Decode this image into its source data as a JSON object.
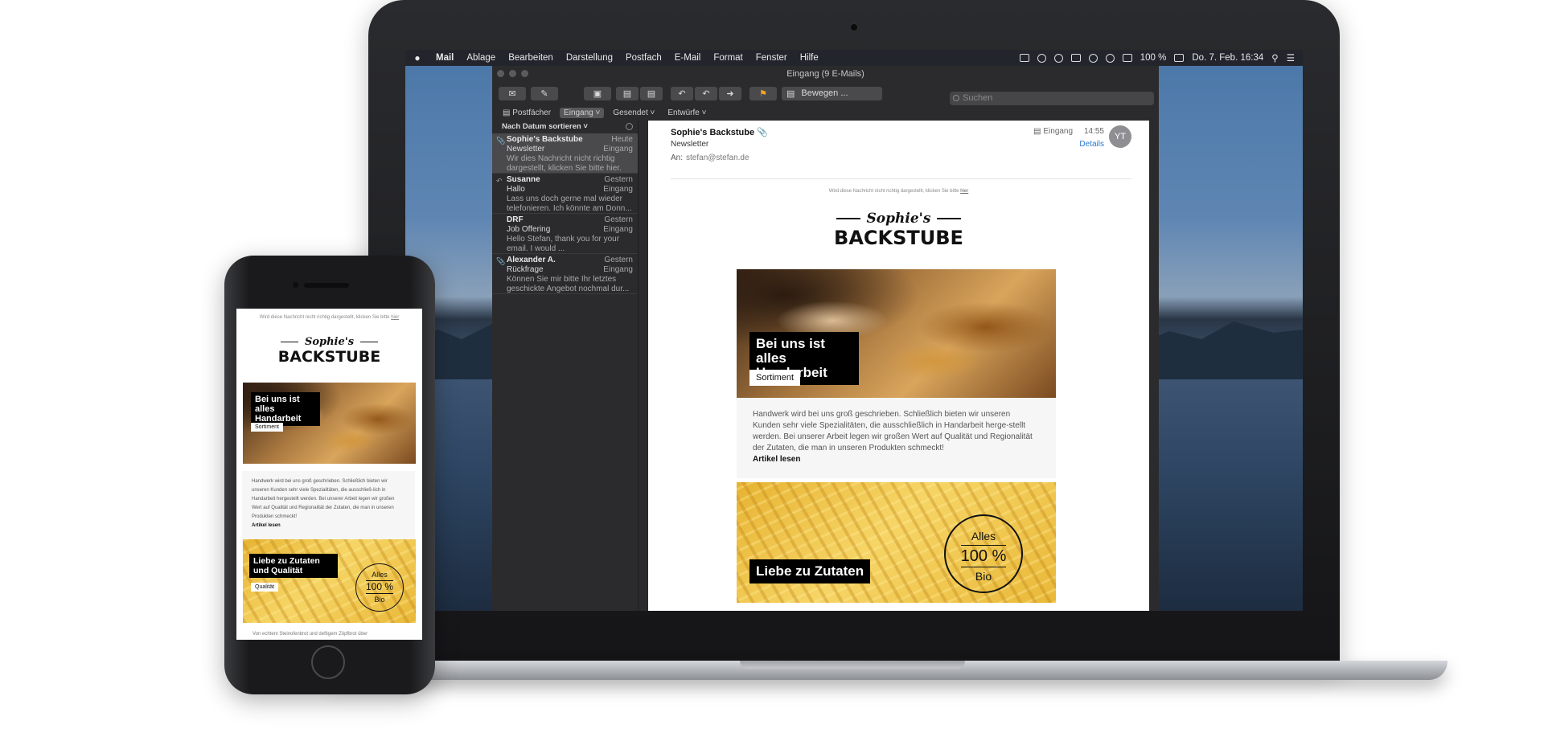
{
  "menubar": {
    "app": "Mail",
    "items": [
      "Ablage",
      "Bearbeiten",
      "Darstellung",
      "Postfach",
      "E-Mail",
      "Format",
      "Fenster",
      "Hilfe"
    ],
    "battery": "100 %",
    "clock": "Do. 7. Feb.  16:34"
  },
  "window": {
    "title": "Eingang (9 E-Mails)"
  },
  "toolbar": {
    "move_label": "Bewegen ...",
    "search_placeholder": "Suchen"
  },
  "favorites": [
    "Postfächer",
    "Eingang",
    "Gesendet",
    "Entwürfe"
  ],
  "sort_label": "Nach Datum sortieren",
  "messages": [
    {
      "from": "Sophie's Backstube",
      "date": "Heute",
      "subject": "Newsletter",
      "mailbox": "Eingang",
      "preview": "Wir dies Nachricht nicht richtig dargestellt, klicken Sie bitte hier."
    },
    {
      "from": "Susanne",
      "date": "Gestern",
      "subject": "Hallo",
      "mailbox": "Eingang",
      "preview": "Lass uns doch gerne mal wieder telefonieren. Ich könnte am Donn..."
    },
    {
      "from": "DRF",
      "date": "Gestern",
      "subject": "Job Offering",
      "mailbox": "Eingang",
      "preview": "Hello Stefan, thank you for your email. I would ..."
    },
    {
      "from": "Alexander A.",
      "date": "Gestern",
      "subject": "Rückfrage",
      "mailbox": "Eingang",
      "preview": "Können Sie mir bitte Ihr letztes geschickte Angebot nochmal dur..."
    }
  ],
  "email": {
    "from": "Sophie's Backstube",
    "subject": "Newsletter",
    "to_label": "An:",
    "to": "stefan@stefan.de",
    "mailbox": "Eingang",
    "time": "14:55",
    "details": "Details",
    "avatar": "YT"
  },
  "newsletter": {
    "topline": "Wird diese Nachricht nicht richtig dargestellt, klicken Sie bitte",
    "topline_link": "hier",
    "logo_script": "Sophie's",
    "logo_word": "BACKSTUBE",
    "hero_title": "Bei uns ist alles Handarbeit",
    "hero_tag": "Sortiment",
    "body": "Handwerk wird bei uns groß geschrieben. Schließlich bieten wir unseren Kunden sehr viele Spezialitäten, die ausschließlich in Handarbeit herge-stellt werden. Bei unserer Arbeit legen wir großen Wert auf Qualität und Regionalität der Zutaten, die man in unseren Produkten schmeckt!",
    "body_phone": "Handwerk wird bei uns groß geschrieben. Schließlich bieten wir unseren Kunden sehr viele Spezialitäten, die ausschließ-lich in Handarbeit hergestellt werden. Bei unserer Arbeit legen wir großen Wert auf Qualität und Regionalität der Zutaten, die man in unseren Produkten schmeckt!",
    "read_more": "Artikel lesen",
    "second_title": "Liebe zu Zutaten",
    "second_title_phone": "Liebe zu Zutaten und Qualität",
    "second_tag": "Qualität",
    "seal_top": "Alles",
    "seal_mid": "100 %",
    "seal_bottom": "Bio",
    "phone_footer": "Von echtem Steinofenbrot und deftigem Zöpfbrot über"
  }
}
